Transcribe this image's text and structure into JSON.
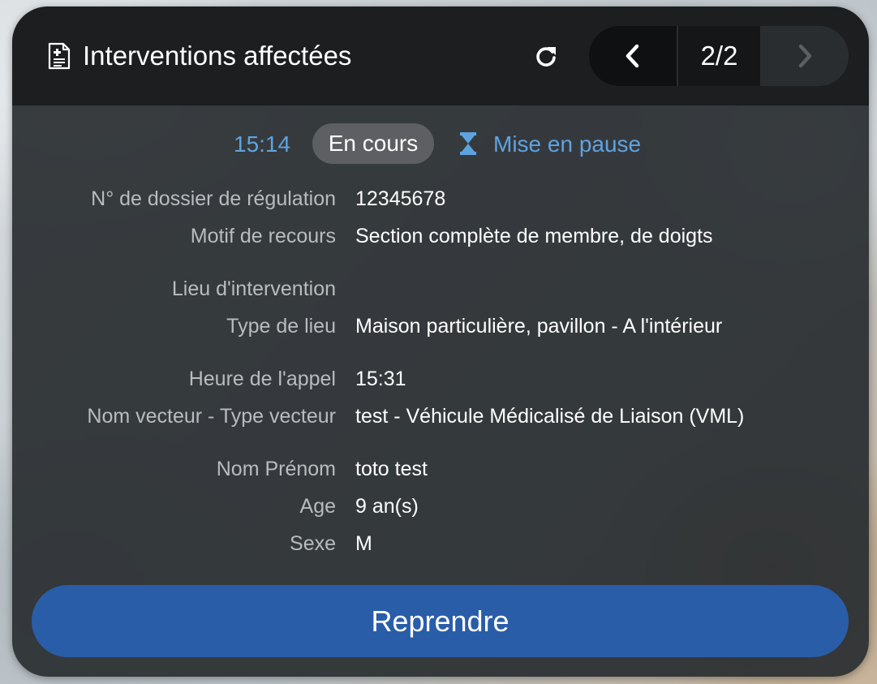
{
  "header": {
    "title": "Interventions affectées",
    "title_icon": "medical-document-icon",
    "refresh_icon": "refresh-icon",
    "pager": {
      "prev_icon": "chevron-left-icon",
      "count": "2/2",
      "next_icon": "chevron-right-icon"
    }
  },
  "status": {
    "time": "15:14",
    "badge": "En cours",
    "pause_icon": "hourglass-icon",
    "pause_label": "Mise en pause"
  },
  "details": [
    {
      "label": "N° de dossier de régulation",
      "value": "12345678"
    },
    {
      "label": "Motif de recours",
      "value": "Section complète de membre, de doigts"
    },
    {
      "label": "Lieu d'intervention",
      "value": ""
    },
    {
      "label": "Type de lieu",
      "value": "Maison particulière, pavillon - A l'intérieur"
    },
    {
      "label": "Heure de l'appel",
      "value": "15:31"
    },
    {
      "label": "Nom vecteur - Type vecteur",
      "value": "test - Véhicule Médicalisé de Liaison (VML)"
    },
    {
      "label": "Nom Prénom",
      "value": "toto test"
    },
    {
      "label": "Age",
      "value": "9 an(s)"
    },
    {
      "label": "Sexe",
      "value": "M"
    }
  ],
  "actions": {
    "resume_label": "Reprendre"
  },
  "colors": {
    "accent_blue": "#5ea3e0",
    "button_blue": "#2a5da8",
    "header_bg": "#1c1e20",
    "card_bg": "#2a2e32"
  }
}
